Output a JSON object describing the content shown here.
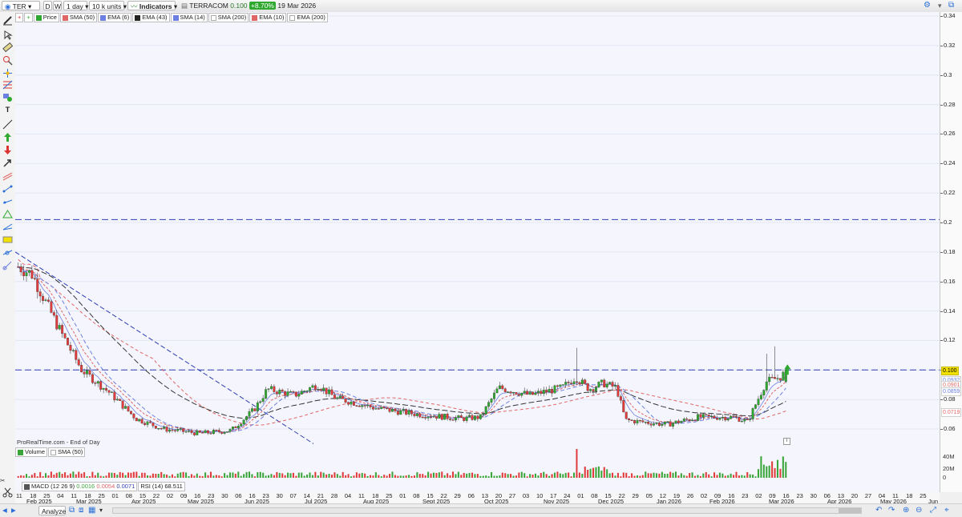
{
  "toolbar": {
    "ticker": "TER",
    "period_d": "D",
    "period_w": "W",
    "timeframe": "1 day",
    "units": "10 k units",
    "indicators": "Indicators",
    "instrument": "TERRACOM",
    "last_price": "0.100",
    "change": "+8.70%",
    "date": "19 Mar 2026"
  },
  "legend": [
    {
      "label": "Price",
      "color": "#2b7a2b",
      "icon": "price-icon"
    },
    {
      "label": "SMA (50)",
      "color": "#e06666"
    },
    {
      "label": "EMA (6)",
      "color": "#6d7fe0"
    },
    {
      "label": "EMA (43)",
      "color": "#222222"
    },
    {
      "label": "SMA (14)",
      "color": "#6d7fe0"
    },
    {
      "label": "SMA (200)",
      "color": "#ffffff"
    },
    {
      "label": "EMA (10)",
      "color": "#e06666"
    },
    {
      "label": "EMA (200)",
      "color": "#ffffff"
    }
  ],
  "watermark": "ProRealTime.com - End of Day",
  "price_axis": {
    "ticks": [
      "0.34",
      "0.32",
      "0.3",
      "0.28",
      "0.26",
      "0.24",
      "0.22",
      "0.2",
      "0.18",
      "0.16",
      "0.14",
      "0.12",
      "0.1",
      "0.08",
      "0.06"
    ],
    "markers": [
      {
        "text": "0.100",
        "bg": "#f2e100",
        "fg": "#000000"
      },
      {
        "text": "0.0932",
        "bg": "#ffffff",
        "fg": "#6d7fe0"
      },
      {
        "text": "0.0901",
        "bg": "#ffffff",
        "fg": "#e06666"
      },
      {
        "text": "0.0859",
        "bg": "#ffffff",
        "fg": "#6d7fe0"
      },
      {
        "text": "0.0719",
        "bg": "#ffffff",
        "fg": "#e06666"
      }
    ]
  },
  "volume_panel": {
    "legend": [
      {
        "label": "Volume",
        "color": "#3aa63a"
      },
      {
        "label": "SMA (50)",
        "color": "#ffffff"
      }
    ],
    "ticks": [
      "40M",
      "20M",
      "0"
    ]
  },
  "indicator_panel": {
    "macd_label": "MACD (12 26 9)",
    "macd_values": [
      "0.0016",
      "0.0054",
      "0.0071"
    ],
    "macd_colors": [
      "#3aa63a",
      "#e06666",
      "#2f3fb0"
    ],
    "rsi_label": "RSI (14)",
    "rsi_value": "68.511"
  },
  "x_axis": {
    "days": [
      "11",
      "18",
      "25",
      "04",
      "11",
      "18",
      "25",
      "01",
      "08",
      "15",
      "22",
      "02",
      "09",
      "16",
      "23",
      "30",
      "06",
      "16",
      "23",
      "30",
      "07",
      "14",
      "21",
      "28",
      "04",
      "11",
      "18",
      "25",
      "01",
      "08",
      "15",
      "22",
      "29",
      "06",
      "13",
      "20",
      "27",
      "03",
      "10",
      "17",
      "24",
      "01",
      "08",
      "15",
      "22",
      "29",
      "05",
      "12",
      "19",
      "26",
      "02",
      "09",
      "16",
      "23",
      "02",
      "09",
      "16",
      "23",
      "30",
      "06",
      "13",
      "20",
      "27",
      "04",
      "11",
      "18",
      "25",
      "01",
      "08",
      "15",
      "22",
      "29",
      "06",
      "13",
      "20",
      "27",
      "04",
      "11",
      "18",
      "25",
      "02"
    ],
    "months": [
      "Feb 2025",
      "Mar 2025",
      "Apr 2025",
      "May 2025",
      "Jun 2025",
      "Jul 2025",
      "Aug 2025",
      "Sept 2025",
      "Oct 2025",
      "Nov 2025",
      "Dec 2025",
      "Jan 2026",
      "Feb 2026",
      "Mar 2026",
      "Apr 2026",
      "May 2026",
      "Jun"
    ]
  },
  "status": {
    "analyze": "Analyze"
  },
  "chart_data": {
    "type": "candlestick",
    "instrument": "TERRACOM",
    "last": 0.1,
    "ylim": [
      0.05,
      0.345
    ],
    "horizontal_lines": [
      0.202,
      0.1
    ],
    "monthly_closes": [
      {
        "x": "Feb 2025",
        "y": 0.165
      },
      {
        "x": "Mar 2025",
        "y": 0.1
      },
      {
        "x": "Apr 2025",
        "y": 0.067
      },
      {
        "x": "May 2025",
        "y": 0.057
      },
      {
        "x": "Jun 2025",
        "y": 0.07
      },
      {
        "x": "Jul 2025",
        "y": 0.085
      },
      {
        "x": "Aug 2025",
        "y": 0.072
      },
      {
        "x": "Sept 2025",
        "y": 0.066
      },
      {
        "x": "Oct 2025",
        "y": 0.085
      },
      {
        "x": "Nov 2025",
        "y": 0.082
      },
      {
        "x": "Dec 2025",
        "y": 0.09
      },
      {
        "x": "Jan 2026",
        "y": 0.064
      },
      {
        "x": "Feb 2026",
        "y": 0.068
      },
      {
        "x": "Mar 2026",
        "y": 0.1
      }
    ]
  }
}
